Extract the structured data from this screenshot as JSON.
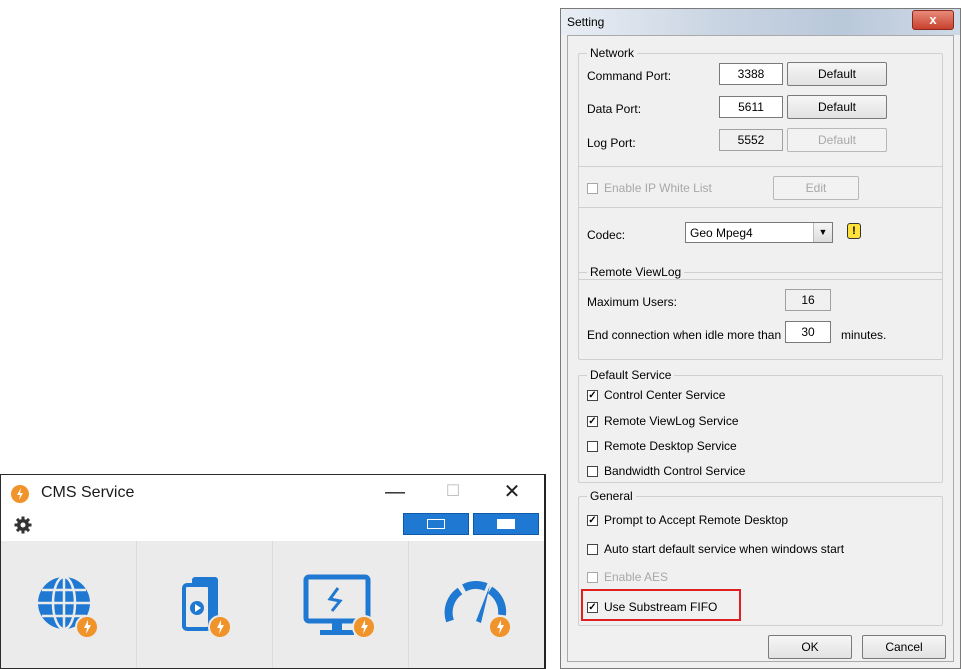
{
  "cms": {
    "title": "CMS Service",
    "window_controls": {
      "minimize": "—",
      "maximize": "☐",
      "close": "✕"
    },
    "tiles": [
      {
        "icon": "globe-icon"
      },
      {
        "icon": "media-device-icon"
      },
      {
        "icon": "remote-desktop-icon"
      },
      {
        "icon": "speedometer-icon"
      }
    ],
    "colors": {
      "accent": "#1f78d1",
      "badge": "#f0932a"
    }
  },
  "setting": {
    "title": "Setting",
    "close_label": "x",
    "network": {
      "title": "Network",
      "command_port_label": "Command Port:",
      "command_port": "3388",
      "data_port_label": "Data Port:",
      "data_port": "5611",
      "log_port_label": "Log Port:",
      "log_port": "5552",
      "default_label": "Default",
      "enable_ip_white_list_label": "Enable IP White List",
      "enable_ip_white_list": false,
      "edit_label": "Edit",
      "codec_label": "Codec:",
      "codec_value": "Geo Mpeg4"
    },
    "remote_viewlog": {
      "title": "Remote ViewLog",
      "max_users_label": "Maximum Users:",
      "max_users": "16",
      "idle_label": "End connection when idle more than",
      "idle_minutes": "30",
      "minutes_label": "minutes."
    },
    "default_service": {
      "title": "Default Service",
      "items": [
        {
          "label": "Control Center Service",
          "checked": true
        },
        {
          "label": "Remote ViewLog Service",
          "checked": true
        },
        {
          "label": "Remote Desktop Service",
          "checked": false
        },
        {
          "label": "Bandwidth Control Service",
          "checked": false
        }
      ]
    },
    "general": {
      "title": "General",
      "items": [
        {
          "label": "Prompt to Accept Remote Desktop",
          "checked": true,
          "enabled": true
        },
        {
          "label": "Auto start default service when windows start",
          "checked": false,
          "enabled": true
        },
        {
          "label": "Enable AES",
          "checked": false,
          "enabled": false
        },
        {
          "label": "Use Substream FIFO",
          "checked": true,
          "enabled": true
        }
      ]
    },
    "ok_label": "OK",
    "cancel_label": "Cancel"
  }
}
